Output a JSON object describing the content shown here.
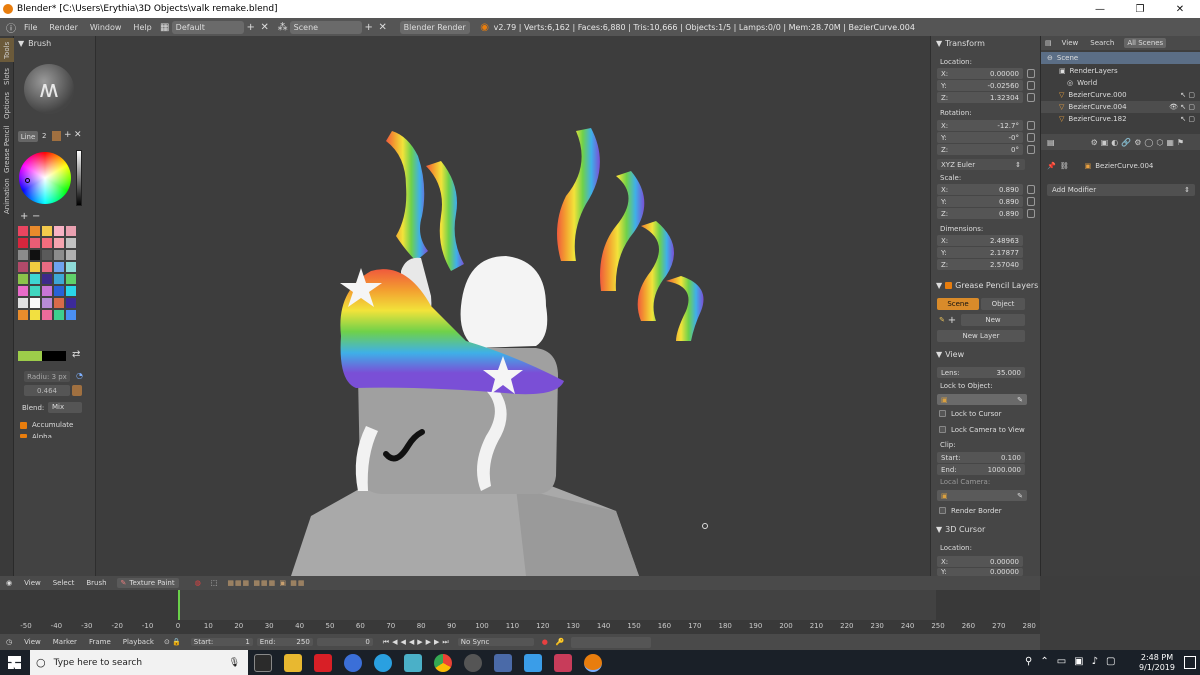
{
  "window": {
    "title": "Blender* [C:\\Users\\Erythia\\3D Objects\\valk remake.blend]",
    "minimize": "—",
    "maximize": "❐",
    "close": "✕"
  },
  "info_header": {
    "menus": [
      "File",
      "Render",
      "Window",
      "Help"
    ],
    "layout": "Default",
    "scene": "Scene",
    "engine": "Blender Render",
    "stats": "v2.79 | Verts:6,162 | Faces:6,880 | Tris:10,666 | Objects:1/5 | Lamps:0/0 | Mem:28.70M | BezierCurve.004"
  },
  "tool_tabs": [
    "Tools",
    "Slots",
    "Options",
    "Grease Pencil",
    "Animation"
  ],
  "tool_shelf": {
    "brush_header": "Brush",
    "line_label": "Line",
    "line_num": "2",
    "radius": "Radiu: 3 px",
    "strength": "0.464",
    "blend_label": "Blend:",
    "blend_value": "Mix",
    "accumulate": "Accumulate",
    "alpha": "Alpha",
    "swatches": [
      "#e94560",
      "#e88a2c",
      "#f2c94c",
      "#f7b2c4",
      "#e9a0b0",
      "#d7263d",
      "#e85d75",
      "#f26d7d",
      "#f5a3ae",
      "#c1c1c1",
      "#8b8b8b",
      "#111111",
      "#5a5a5a",
      "#8c8c8c",
      "#b0b0b0",
      "#b34a6a",
      "#f2cc40",
      "#e96b82",
      "#6fa3ef",
      "#8edbd8",
      "#8bc34a",
      "#3ed6d2",
      "#3e2a8a",
      "#3ea7d6",
      "#5fd16a",
      "#e86bc9",
      "#40d6c0",
      "#c975d6",
      "#2962d6",
      "#2ad6e9",
      "#e0e0e0",
      "#fafafa",
      "#b88bd6",
      "#d86b4a",
      "#3c2a9a",
      "#e88c2c",
      "#f2e040",
      "#eb6b9b",
      "#3ecf8e",
      "#4a8ff2"
    ]
  },
  "n_panel": {
    "transform_header": "Transform",
    "location_label": "Location:",
    "location": [
      {
        "axis": "X:",
        "value": "0.00000"
      },
      {
        "axis": "Y:",
        "value": "-0.02560"
      },
      {
        "axis": "Z:",
        "value": "1.32304"
      }
    ],
    "rotation_label": "Rotation:",
    "rotation": [
      {
        "axis": "X:",
        "value": "-12.7°"
      },
      {
        "axis": "Y:",
        "value": "-0°"
      },
      {
        "axis": "Z:",
        "value": "0°"
      }
    ],
    "rotation_mode": "XYZ Euler",
    "scale_label": "Scale:",
    "scale": [
      {
        "axis": "X:",
        "value": "0.890"
      },
      {
        "axis": "Y:",
        "value": "0.890"
      },
      {
        "axis": "Z:",
        "value": "0.890"
      }
    ],
    "dimensions_label": "Dimensions:",
    "dimensions": [
      {
        "axis": "X:",
        "value": "2.48963"
      },
      {
        "axis": "Y:",
        "value": "2.17877"
      },
      {
        "axis": "Z:",
        "value": "2.57040"
      }
    ],
    "gp_header": "Grease Pencil Layers",
    "gp_scene": "Scene",
    "gp_object": "Object",
    "gp_new": "New",
    "gp_new_layer": "New Layer",
    "view_header": "View",
    "lens_label": "Lens:",
    "lens_value": "35.000",
    "lock_obj": "Lock to Object:",
    "lock_cursor": "Lock to Cursor",
    "lock_camera": "Lock Camera to View",
    "clip_label": "Clip:",
    "clip_start_label": "Start:",
    "clip_start": "0.100",
    "clip_end_label": "End:",
    "clip_end": "1000.000",
    "local_camera": "Local Camera:",
    "render_border": "Render Border",
    "cursor_header": "3D Cursor",
    "cursor_location": "Location:",
    "cursor_x_label": "X:",
    "cursor_x": "0.00000",
    "cursor_y_label": "Y:",
    "cursor_y": "0.00000"
  },
  "outliner": {
    "tabs": [
      "View",
      "Search",
      "All Scenes"
    ],
    "rows": [
      "Scene",
      "RenderLayers",
      "World",
      "BezierCurve.000",
      "BezierCurve.004",
      "BezierCurve.182"
    ]
  },
  "properties": {
    "object": "BezierCurve.004",
    "add_modifier": "Add Modifier"
  },
  "viewport_header": {
    "menus": [
      "View",
      "Select",
      "Brush"
    ],
    "mode": "Texture Paint"
  },
  "timeline": {
    "ticks": [
      "-50",
      "-40",
      "-30",
      "-20",
      "-10",
      "0",
      "10",
      "20",
      "30",
      "40",
      "50",
      "60",
      "70",
      "80",
      "90",
      "100",
      "110",
      "120",
      "130",
      "140",
      "150",
      "160",
      "170",
      "180",
      "190",
      "200",
      "210",
      "220",
      "230",
      "240",
      "250",
      "260",
      "270",
      "280"
    ],
    "menus": [
      "View",
      "Marker",
      "Frame",
      "Playback"
    ],
    "start_label": "Start:",
    "start": "1",
    "end_label": "End:",
    "end": "250",
    "current": "0",
    "sync": "No Sync"
  },
  "taskbar": {
    "search_placeholder": "Type here to search",
    "time": "2:48 PM",
    "date": "9/1/2019"
  }
}
